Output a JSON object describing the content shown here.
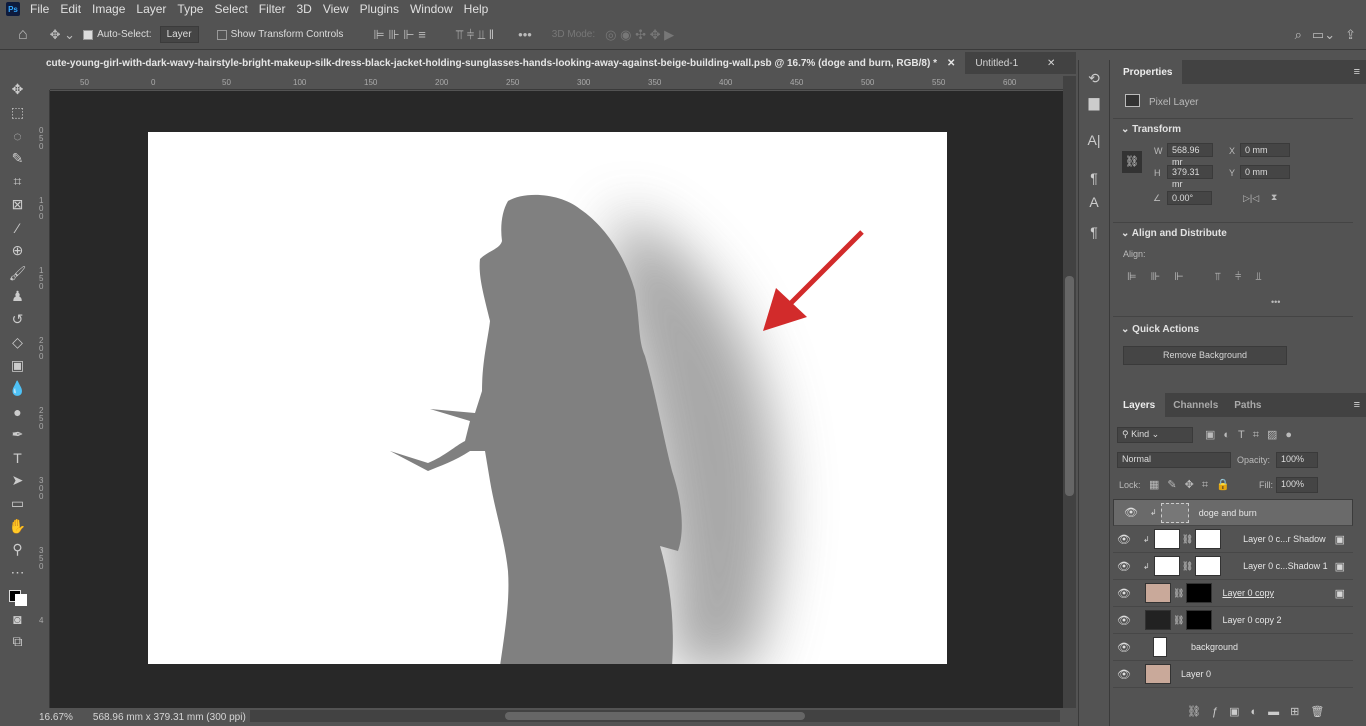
{
  "menu": {
    "app_icon": "Ps",
    "items": [
      "File",
      "Edit",
      "Image",
      "Layer",
      "Type",
      "Select",
      "Filter",
      "3D",
      "View",
      "Plugins",
      "Window",
      "Help"
    ]
  },
  "options": {
    "auto_select_label": "Auto-Select:",
    "auto_select_checked": true,
    "target": "Layer",
    "show_transform_label": "Show Transform Controls",
    "show_transform_checked": false,
    "mode_3d_label": "3D Mode:"
  },
  "tabs": [
    {
      "label": "cute-young-girl-with-dark-wavy-hairstyle-bright-makeup-silk-dress-black-jacket-holding-sunglasses-hands-looking-away-against-beige-building-wall.psb @ 16.7% (doge and burn, RGB/8) *",
      "active": true
    },
    {
      "label": "Untitled-1",
      "active": false
    }
  ],
  "ruler": {
    "top": [
      "50",
      "0",
      "50",
      "100",
      "150",
      "200",
      "250",
      "300",
      "350",
      "400",
      "450",
      "500",
      "550",
      "600"
    ],
    "left": [
      "0",
      "5",
      "0",
      "1",
      "0",
      "0",
      "1",
      "5",
      "0",
      "2",
      "0",
      "0",
      "2",
      "5",
      "0",
      "3",
      "0",
      "0",
      "3",
      "5",
      "0",
      "4"
    ]
  },
  "status": {
    "zoom": "16.67%",
    "doc_info": "568.96 mm x 379.31 mm (300 ppi)"
  },
  "properties": {
    "tab": "Properties",
    "layer_type": "Pixel Layer",
    "transform": {
      "title": "Transform",
      "w_label": "W",
      "w": "568.96 mr",
      "h_label": "H",
      "h": "379.31 mr",
      "x_label": "X",
      "x": "0 mm",
      "y_label": "Y",
      "y": "0 mm",
      "angle": "0.00°"
    },
    "align": {
      "title": "Align and Distribute",
      "align_label": "Align:"
    },
    "quick_actions": {
      "title": "Quick Actions",
      "remove_bg": "Remove Background"
    }
  },
  "layers_panel": {
    "tabs": [
      "Layers",
      "Channels",
      "Paths"
    ],
    "filter": "Kind",
    "blend": "Normal",
    "opacity_label": "Opacity:",
    "opacity": "100%",
    "lock_label": "Lock:",
    "fill_label": "Fill:",
    "fill": "100%",
    "layers": [
      {
        "name": "doge and burn",
        "selected": true
      },
      {
        "name": "Layer 0 c...r Shadow"
      },
      {
        "name": "Layer 0 c...Shadow 1"
      },
      {
        "name": "Layer 0 copy"
      },
      {
        "name": "Layer 0 copy 2"
      },
      {
        "name": "background"
      },
      {
        "name": "Layer 0"
      }
    ]
  },
  "colors": {
    "arrow": "#d22b2b",
    "silhouette": "#808080",
    "accent": "#31a8ff"
  }
}
